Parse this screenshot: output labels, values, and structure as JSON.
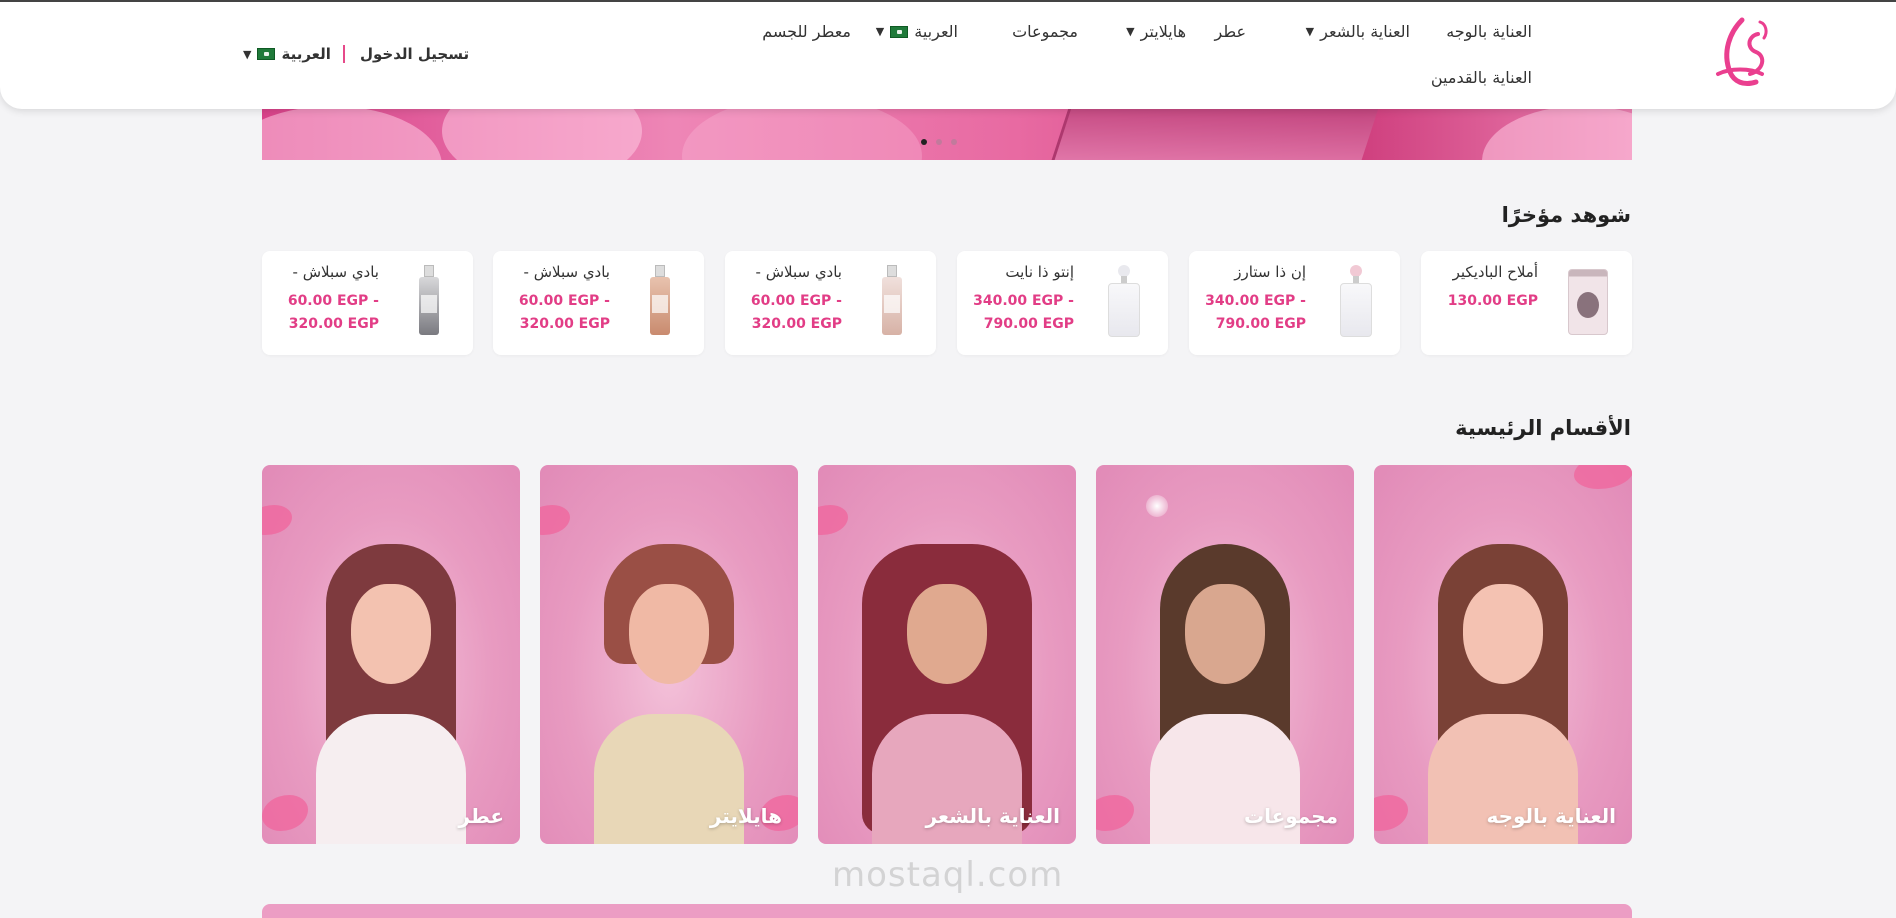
{
  "header": {
    "nav": {
      "face_care": "العناية بالوجه",
      "hair_care": "العناية بالشعر",
      "perfume": "عطر",
      "highlighter": "هايلايتر",
      "collections": "مجموعات",
      "language": "العربية",
      "body_mist": "معطر للجسم",
      "foot_care": "العناية بالقدمين"
    },
    "login": "تسجيل الدخول",
    "language": "العربية"
  },
  "hero": {
    "slides": 3,
    "active_slide": 1
  },
  "recently_viewed": {
    "title": "شوهد مؤخرًا",
    "items": [
      {
        "name": "أملاح الباديكير",
        "price_line1": "130.00 EGP",
        "price_line2": ""
      },
      {
        "name": "إن ذا ستارز",
        "price_line1": "340.00 EGP -",
        "price_line2": "790.00 EGP"
      },
      {
        "name": "إنتو ذا نايت",
        "price_line1": "340.00 EGP -",
        "price_line2": "790.00 EGP"
      },
      {
        "name": "بادي سبلاش -",
        "price_line1": "60.00 EGP -",
        "price_line2": "320.00 EGP"
      },
      {
        "name": "بادي سبلاش -",
        "price_line1": "60.00 EGP -",
        "price_line2": "320.00 EGP"
      },
      {
        "name": "بادي سبلاش -",
        "price_line1": "60.00 EGP -",
        "price_line2": "320.00 EGP"
      }
    ]
  },
  "main_categories": {
    "title": "الأقسام الرئيسية",
    "items": [
      {
        "label": "العناية بالوجه"
      },
      {
        "label": "مجموعات"
      },
      {
        "label": "العناية بالشعر"
      },
      {
        "label": "هايلايتر"
      },
      {
        "label": "عطر"
      }
    ]
  },
  "watermark": "mostaql.com",
  "colors": {
    "accent": "#e23d86",
    "brand_pink": "#e89bc1"
  }
}
